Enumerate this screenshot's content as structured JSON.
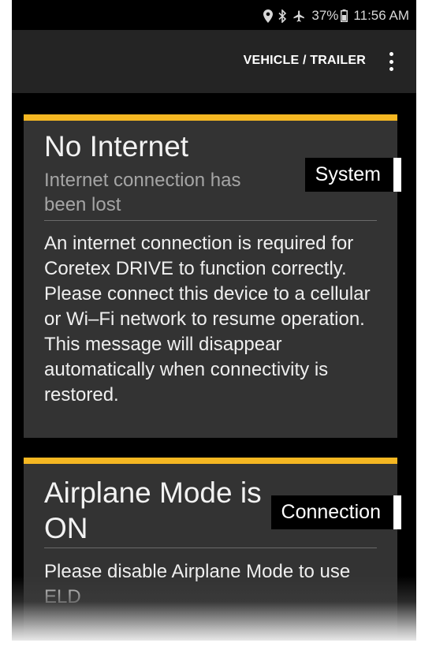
{
  "status_bar": {
    "battery_percent": "37%",
    "time": "11:56 AM",
    "icons": [
      "location-icon",
      "bluetooth-icon",
      "airplane-icon",
      "battery-icon"
    ]
  },
  "app_bar": {
    "action_label": "VEHICLE / TRAILER",
    "menu_icon": "more-vert-icon"
  },
  "colors": {
    "accent": "#f5b722",
    "card_bg": "#333333",
    "appbar_bg": "#242424",
    "screen_bg": "#000000"
  },
  "alerts": [
    {
      "title": "No Internet",
      "subtitle": "Internet connection has been lost",
      "tag": "System",
      "body": "An internet connection is required for Coretex DRIVE to function correctly. Please connect this device to a cellular or Wi–Fi network to resume operation. This message will disappear automatically when connectivity is restored."
    },
    {
      "title": "Airplane Mode is ON",
      "tag": "Connection",
      "body": "Please disable Airplane Mode to use ELD"
    }
  ]
}
